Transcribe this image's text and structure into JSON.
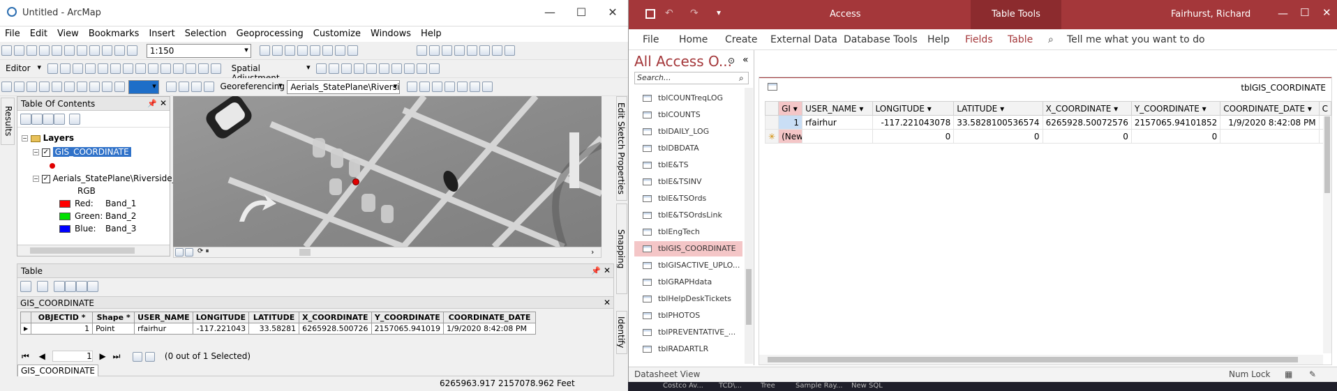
{
  "arcmap": {
    "title": "Untitled - ArcMap",
    "menu": [
      "File",
      "Edit",
      "View",
      "Bookmarks",
      "Insert",
      "Selection",
      "Geoprocessing",
      "Customize",
      "Windows",
      "Help"
    ],
    "scale": "1:150",
    "editor_label": "Editor",
    "spatial_adjustment_label": "Spatial Adjustment",
    "georeferencing_label": "Georeferencing",
    "georef_layer": "Aerials_StatePlane\\Riverside_Co",
    "results_tab": "Results",
    "toc": {
      "title": "Table Of Contents",
      "layers_label": "Layers",
      "layer1": "GIS_COORDINATE",
      "layer2": "Aerials_StatePlane\\Riverside_",
      "rgb_label": "RGB",
      "bands": [
        {
          "label": "Red:",
          "band": "Band_1",
          "color": "#ff0000"
        },
        {
          "label": "Green:",
          "band": "Band_2",
          "color": "#00e000"
        },
        {
          "label": "Blue:",
          "band": "Band_3",
          "color": "#0000ff"
        }
      ]
    },
    "side_tabs": [
      "Edit Sketch Properties",
      "Snapping Environment",
      "Identify"
    ],
    "table": {
      "pane_title": "Table",
      "layer_title": "GIS_COORDINATE",
      "columns": [
        "OBJECTID *",
        "Shape *",
        "USER_NAME",
        "LONGITUDE",
        "LATITUDE",
        "X_COORDINATE",
        "Y_COORDINATE",
        "COORDINATE_DATE"
      ],
      "row": [
        "1",
        "Point",
        "rfairhur",
        "-117.221043",
        "33.58281",
        "6265928.500726",
        "2157065.941019",
        "1/9/2020 8:42:08 PM"
      ],
      "record": "1",
      "selection": "(0 out of 1 Selected)",
      "bottom_tab": "GIS_COORDINATE"
    },
    "status_coords": "6265963.917  2157078.962 Feet"
  },
  "access": {
    "app_title": "Access",
    "table_tools": "Table Tools",
    "user": "Fairhurst, Richard",
    "ribbon": [
      "File",
      "Home",
      "Create",
      "External Data",
      "Database Tools",
      "Help",
      "Fields",
      "Table"
    ],
    "tell_me": "Tell me what you want to do",
    "nav_title": "All Access O...",
    "search_placeholder": "Search...",
    "nav_items": [
      "tblCOUNTreqLOG",
      "tblCOUNTS",
      "tblDAILY_LOG",
      "tblDBDATA",
      "tblE&TS",
      "tblE&TSINV",
      "tblE&TSOrds",
      "tblE&TSOrdsLink",
      "tblEngTech",
      "tblGIS_COORDINATE",
      "tblGISACTIVE_UPLO...",
      "tblGRAPHdata",
      "tblHelpDeskTickets",
      "tblPHOTOS",
      "tblPREVENTATIVE_...",
      "tblRADARTLR"
    ],
    "tab_name": "tblGIS_COORDINATE",
    "columns": [
      "GI",
      "USER_NAME",
      "LONGITUDE",
      "LATITUDE",
      "X_COORDINATE",
      "Y_COORDINATE",
      "COORDINATE_DATE",
      "C"
    ],
    "row1": [
      "1",
      "rfairhur",
      "-117.221043078",
      "33.5828100536574",
      "6265928.50072576",
      "2157065.94101852",
      "1/9/2020 8:42:08 PM"
    ],
    "new_row": [
      "(New)",
      "",
      "0",
      "0",
      "0",
      "0",
      ""
    ],
    "status_left": "Datasheet View",
    "status_right": "Num Lock",
    "taskbar": [
      "Costco Av...",
      "TCD\\...",
      "Tree",
      "Sample Ray...",
      "New SQL"
    ]
  }
}
